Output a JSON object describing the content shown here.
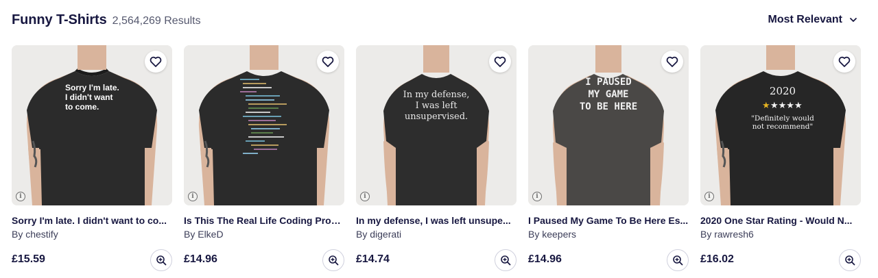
{
  "header": {
    "title": "Funny T-Shirts",
    "result_count": "2,564,269 Results",
    "sort_label": "Most Relevant"
  },
  "colors": {
    "text_primary": "#171740",
    "text_secondary": "#55586e",
    "border": "#cfd0dd"
  },
  "icons": [
    "heart-icon",
    "info-icon",
    "zoom-in-icon",
    "chevron-down-icon"
  ],
  "products": [
    {
      "name": "Sorry I'm late. I didn't want to co...",
      "artist": "By chestify",
      "price": "£15.59",
      "shirt_text": [
        "Sorry I'm late.",
        "I didn't want",
        "to come."
      ]
    },
    {
      "name": "Is This The Real Life Coding Prog...",
      "artist": "By ElkeD",
      "price": "£14.96"
    },
    {
      "name": "In my defense, I was left unsupe...",
      "artist": "By digerati",
      "price": "£14.74",
      "shirt_text": [
        "In my defense,",
        "I was left",
        "unsupervised."
      ]
    },
    {
      "name": "I Paused My Game To Be Here Es...",
      "artist": "By keepers",
      "price": "£14.96",
      "shirt_text": [
        "I PAUSED",
        "MY GAME",
        "TO BE HERE"
      ]
    },
    {
      "name": "2020 One Star Rating - Would N...",
      "artist": "By rawresh6",
      "price": "£16.02",
      "shirt_text": [
        "2020",
        "\"Definitely would",
        "not recommend\""
      ]
    }
  ]
}
